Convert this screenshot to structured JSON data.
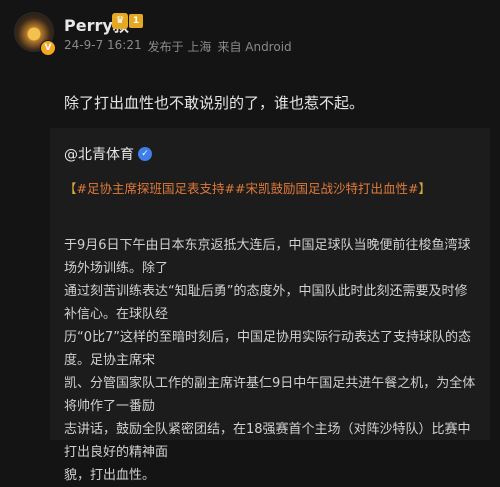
{
  "user": {
    "name": "Perry叔",
    "level": "1",
    "avatar_badge": "V",
    "timestamp": "24-9-7 16:21",
    "location": "发布于 上海",
    "device": "来自 Android"
  },
  "post": {
    "text": "除了打出血性也不敢说别的了，谁也惹不起。"
  },
  "quoted": {
    "author": "@北青体育",
    "hashtags_prefix": "【",
    "hashtag_1": "#足协主席探班国足表支持#",
    "hashtag_2": "#宋凯鼓励国足战沙特打出血性#",
    "hashtags_suffix": "】",
    "lines": [
      "于9月6日下午由日本东京返抵大连后，中国足球队当晚便前往梭鱼湾球场外场训练。除了",
      "通过刻苦训练表达“知耻后勇”的态度外，中国队此时此刻还需要及时修补信心。在球队经",
      "历“0比7”这样的至暗时刻后，中国足协用实际行动表达了支持球队的态度。足协主席宋",
      "凯、分管国家队工作的副主席许基仁9日中午国足共进午餐之机，为全体将帅作了一番励",
      "志讲话，鼓励全队紧密团结，在18强赛首个主场（对阵沙特队）比赛中打出良好的精神面",
      "貌，打出血性。"
    ]
  },
  "colors": {
    "background": "#141414",
    "quote_background": "#1c1c1c",
    "hashtag": "#e07a3a",
    "verified": "#3d7ee8",
    "vip": "#e5a823"
  }
}
